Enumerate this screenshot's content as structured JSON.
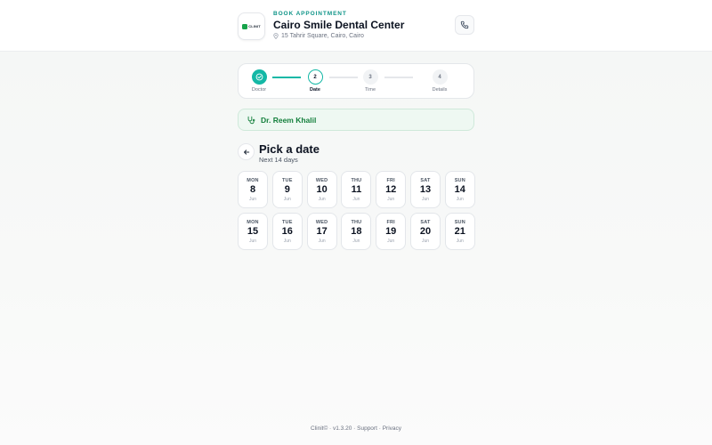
{
  "header": {
    "logo_text": "CLINIT",
    "eyebrow": "BOOK APPOINTMENT",
    "title": "Cairo Smile Dental Center",
    "address": "15 Tahrir Square, Cairo, Cairo"
  },
  "stepper": {
    "steps": [
      {
        "number": "",
        "label": "Doctor",
        "state": "done"
      },
      {
        "number": "2",
        "label": "Date",
        "state": "current"
      },
      {
        "number": "3",
        "label": "Time",
        "state": "todo"
      },
      {
        "number": "4",
        "label": "Details",
        "state": "todo"
      }
    ]
  },
  "doctor": {
    "name": "Dr. Reem Khalil"
  },
  "picker": {
    "title": "Pick a date",
    "subtitle": "Next 14 days",
    "dates": [
      {
        "dow": "MON",
        "day": "8",
        "month": "Jun"
      },
      {
        "dow": "TUE",
        "day": "9",
        "month": "Jun"
      },
      {
        "dow": "WED",
        "day": "10",
        "month": "Jun"
      },
      {
        "dow": "THU",
        "day": "11",
        "month": "Jun"
      },
      {
        "dow": "FRI",
        "day": "12",
        "month": "Jun"
      },
      {
        "dow": "SAT",
        "day": "13",
        "month": "Jun"
      },
      {
        "dow": "SUN",
        "day": "14",
        "month": "Jun"
      },
      {
        "dow": "MON",
        "day": "15",
        "month": "Jun"
      },
      {
        "dow": "TUE",
        "day": "16",
        "month": "Jun"
      },
      {
        "dow": "WED",
        "day": "17",
        "month": "Jun"
      },
      {
        "dow": "THU",
        "day": "18",
        "month": "Jun"
      },
      {
        "dow": "FRI",
        "day": "19",
        "month": "Jun"
      },
      {
        "dow": "SAT",
        "day": "20",
        "month": "Jun"
      },
      {
        "dow": "SUN",
        "day": "21",
        "month": "Jun"
      }
    ]
  },
  "footer": {
    "brand": "Clinit© · v1.3.20 · ",
    "support": "Support",
    "sep": " · ",
    "privacy": "Privacy"
  },
  "colors": {
    "accent": "#14b8a6",
    "eyebrow": "#0f9488",
    "doctor_text": "#15803d",
    "doctor_bg": "#eef8f2"
  },
  "icons": {
    "pin": "map-pin-icon",
    "phone": "phone-icon",
    "check": "check-circle-icon",
    "stethoscope": "stethoscope-icon",
    "back": "arrow-left-icon"
  }
}
